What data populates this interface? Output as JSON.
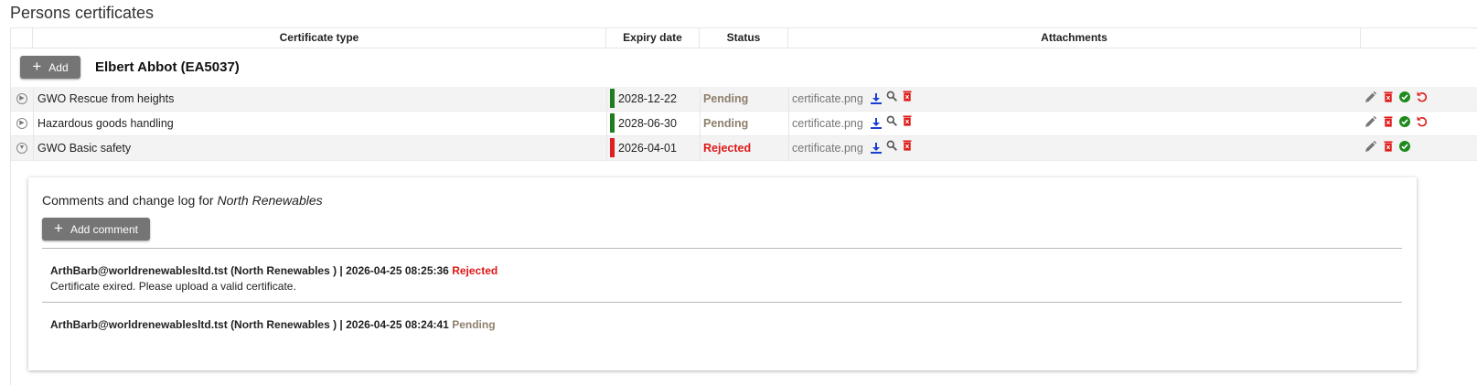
{
  "page": {
    "title": "Persons certificates"
  },
  "columns": {
    "certificate_type": "Certificate type",
    "expiry_date": "Expiry date",
    "status": "Status",
    "attachments": "Attachments"
  },
  "person": {
    "add_label": "Add",
    "name": "Elbert Abbot (EA5037)"
  },
  "colors": {
    "valid": "#1e7d1e",
    "expired": "#e02020",
    "pending": "#8d7f6c",
    "rejected": "#e01818",
    "download": "#1a3fd0",
    "delete": "#e01818",
    "approve": "#1e8a1e"
  },
  "certificates": [
    {
      "type": "GWO Rescue from heights",
      "expiry": "2028-12-22",
      "status": "Pending",
      "attachment": "certificate.png",
      "expander": "play-circle-icon",
      "actions": [
        "edit-icon",
        "delete-icon",
        "approve-icon",
        "revert-icon"
      ]
    },
    {
      "type": "Hazardous goods handling",
      "expiry": "2028-06-30",
      "status": "Pending",
      "attachment": "certificate.png",
      "expander": "play-circle-icon",
      "actions": [
        "edit-icon",
        "delete-icon",
        "approve-icon",
        "revert-icon"
      ]
    },
    {
      "type": "GWO Basic safety",
      "expiry": "2026-04-01",
      "status": "Rejected",
      "attachment": "certificate.png",
      "expander": "collapse-circle-icon",
      "actions": [
        "edit-icon",
        "delete-icon",
        "approve-icon"
      ]
    }
  ],
  "comments": {
    "title_prefix": "Comments and change log for",
    "company": "North Renewables",
    "add_label": "Add comment",
    "entries": [
      {
        "header": "ArthBarb@worldrenewablesltd.tst (North Renewables ) | 2026-04-25 08:25:36",
        "status": "Rejected",
        "text": "Certificate exired. Please upload a valid certificate."
      },
      {
        "header": "ArthBarb@worldrenewablesltd.tst (North Renewables ) | 2026-04-25 08:24:41",
        "status": "Pending",
        "text": ""
      }
    ]
  }
}
